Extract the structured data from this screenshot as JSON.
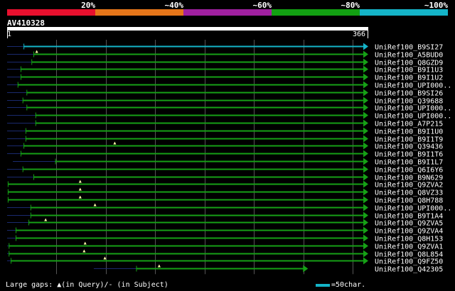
{
  "legend": {
    "percent_labels": [
      "20%",
      "~40%",
      "~60%",
      "~80%",
      "~100%"
    ],
    "colors": [
      "#e8102e",
      "#e6761a",
      "#a020a0",
      "#12a012",
      "#14b4c8"
    ]
  },
  "query": {
    "id": "AV410328",
    "ruler_start": "1",
    "ruler_end": "366"
  },
  "colors": {
    "grid": "#555555",
    "left_overhang": "#1a2a6e",
    "hit_line": "#16a016",
    "top_hit_line": "#14b4c8",
    "gap_marker": "#ffffaa"
  },
  "hits": [
    {
      "name": "UniRef100_B9SI27",
      "start": 18,
      "end": 366,
      "gaps": [],
      "top": true
    },
    {
      "name": "UniRef100_A5BUD0",
      "start": 28,
      "end": 366,
      "gaps": [
        31
      ]
    },
    {
      "name": "UniRef100_Q8GZD9",
      "start": 26,
      "end": 366,
      "gaps": []
    },
    {
      "name": "UniRef100_B9I1U3",
      "start": 15,
      "end": 366,
      "gaps": []
    },
    {
      "name": "UniRef100_B9I1U2",
      "start": 15,
      "end": 366,
      "gaps": []
    },
    {
      "name": "UniRef100_UPI000..",
      "start": 12,
      "end": 366,
      "gaps": []
    },
    {
      "name": "UniRef100_B9SI26",
      "start": 21,
      "end": 366,
      "gaps": []
    },
    {
      "name": "UniRef100_Q39688",
      "start": 17,
      "end": 366,
      "gaps": []
    },
    {
      "name": "UniRef100_UPI000..",
      "start": 21,
      "end": 366,
      "gaps": []
    },
    {
      "name": "UniRef100_UPI000..",
      "start": 30,
      "end": 366,
      "gaps": []
    },
    {
      "name": "UniRef100_A7P215",
      "start": 30,
      "end": 366,
      "gaps": []
    },
    {
      "name": "UniRef100_B9I1U0",
      "start": 20,
      "end": 366,
      "gaps": []
    },
    {
      "name": "UniRef100_B9I1T9",
      "start": 20,
      "end": 366,
      "gaps": []
    },
    {
      "name": "UniRef100_Q39436",
      "start": 18,
      "end": 366,
      "gaps": [
        110
      ]
    },
    {
      "name": "UniRef100_B9I1T6",
      "start": 15,
      "end": 366,
      "gaps": []
    },
    {
      "name": "UniRef100_B9I1L7",
      "start": 50,
      "end": 366,
      "gaps": []
    },
    {
      "name": "UniRef100_Q6I6Y6",
      "start": 17,
      "end": 366,
      "gaps": []
    },
    {
      "name": "UniRef100_B9N629",
      "start": 28,
      "end": 366,
      "gaps": []
    },
    {
      "name": "UniRef100_Q9ZVA2",
      "start": 2,
      "end": 366,
      "gaps": [
        75
      ]
    },
    {
      "name": "UniRef100_Q8VZ33",
      "start": 2,
      "end": 366,
      "gaps": [
        75
      ]
    },
    {
      "name": "UniRef100_Q8H788",
      "start": 2,
      "end": 366,
      "gaps": [
        75
      ]
    },
    {
      "name": "UniRef100_UPI000..",
      "start": 25,
      "end": 366,
      "gaps": [
        90
      ]
    },
    {
      "name": "UniRef100_B9T1A4",
      "start": 25,
      "end": 366,
      "gaps": []
    },
    {
      "name": "UniRef100_Q9ZVA5",
      "start": 23,
      "end": 366,
      "gaps": [
        40
      ]
    },
    {
      "name": "UniRef100_Q9ZVA4",
      "start": 10,
      "end": 366,
      "gaps": []
    },
    {
      "name": "UniRef100_Q8H153",
      "start": 10,
      "end": 366,
      "gaps": []
    },
    {
      "name": "UniRef100_Q9ZVA1",
      "start": 3,
      "end": 366,
      "gaps": [
        80
      ]
    },
    {
      "name": "UniRef100_Q8L854",
      "start": 3,
      "end": 366,
      "gaps": [
        79
      ]
    },
    {
      "name": "UniRef100_Q9FZ50",
      "start": 5,
      "end": 366,
      "gaps": [
        100
      ]
    },
    {
      "name": "UniRef100_Q42305",
      "start": 132,
      "end": 305,
      "gaps": [
        155
      ]
    }
  ],
  "footer": {
    "gaps_text": "Large gaps: ▲(in Query)/- (in Subject)",
    "scale_text": "=50char."
  }
}
